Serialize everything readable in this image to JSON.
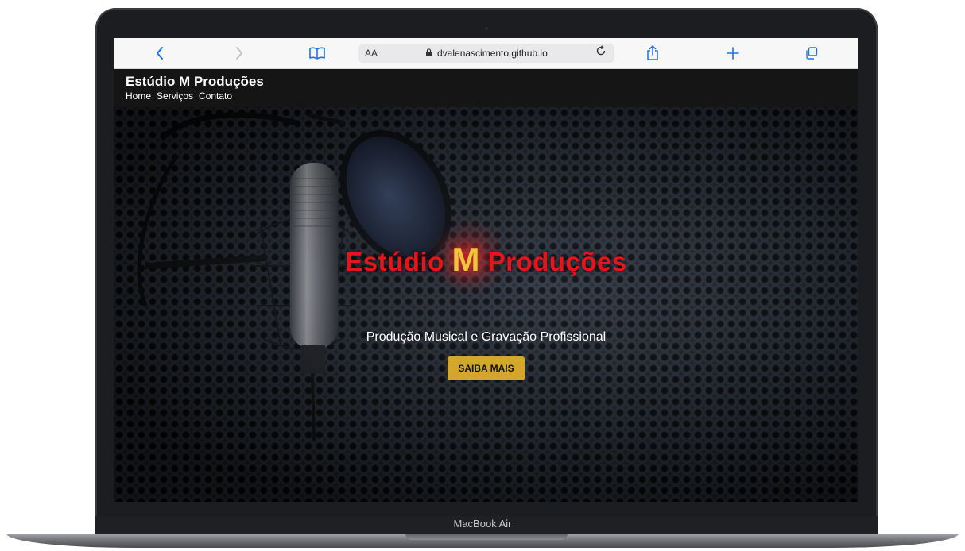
{
  "device": {
    "model_label": "MacBook Air"
  },
  "browser": {
    "address_prefix": "AA",
    "url": "dvalenascimento.github.io",
    "icons": {
      "back": "chevron-left-icon",
      "forward": "chevron-right-icon",
      "bookmarks": "book-icon",
      "lock": "lock-icon",
      "reload": "reload-icon",
      "share": "share-icon",
      "new_tab": "plus-icon",
      "tabs": "tabs-icon"
    },
    "accent_color": "#1a73e8"
  },
  "site": {
    "header_title": "Estúdio M Produções",
    "nav": [
      {
        "label": "Home"
      },
      {
        "label": "Serviços"
      },
      {
        "label": "Contato"
      }
    ]
  },
  "hero": {
    "title_prefix": "Estúdio",
    "title_letter": "M",
    "title_suffix": "Produções",
    "subtitle": "Produção Musical e Gravação Profissional",
    "button_label": "SAIBA MAIS",
    "colors": {
      "title": "#e8141c",
      "letter": "#f2c43a",
      "button": "#d4a72c"
    }
  }
}
